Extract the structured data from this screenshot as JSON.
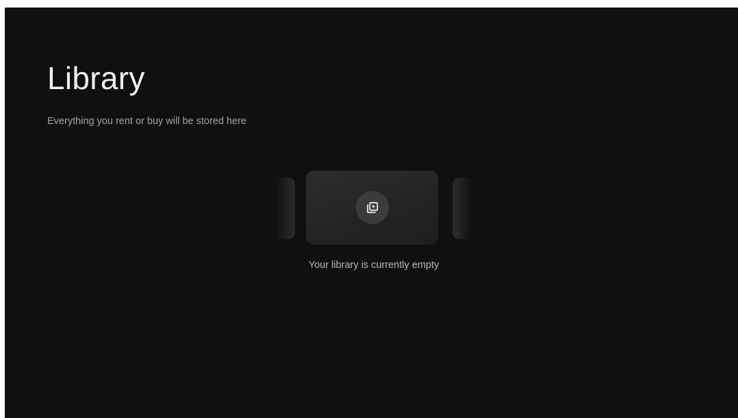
{
  "page": {
    "title": "Library",
    "subtitle": "Everything you rent or buy will be stored here"
  },
  "empty_state": {
    "message": "Your library is currently empty",
    "icon": "video-library-icon"
  },
  "colors": {
    "background": "#0f1011",
    "title_text": "#eef0f1",
    "subtitle_text": "#a3a6a8",
    "card": "#242527",
    "icon_circle": "#3a3b3d"
  }
}
